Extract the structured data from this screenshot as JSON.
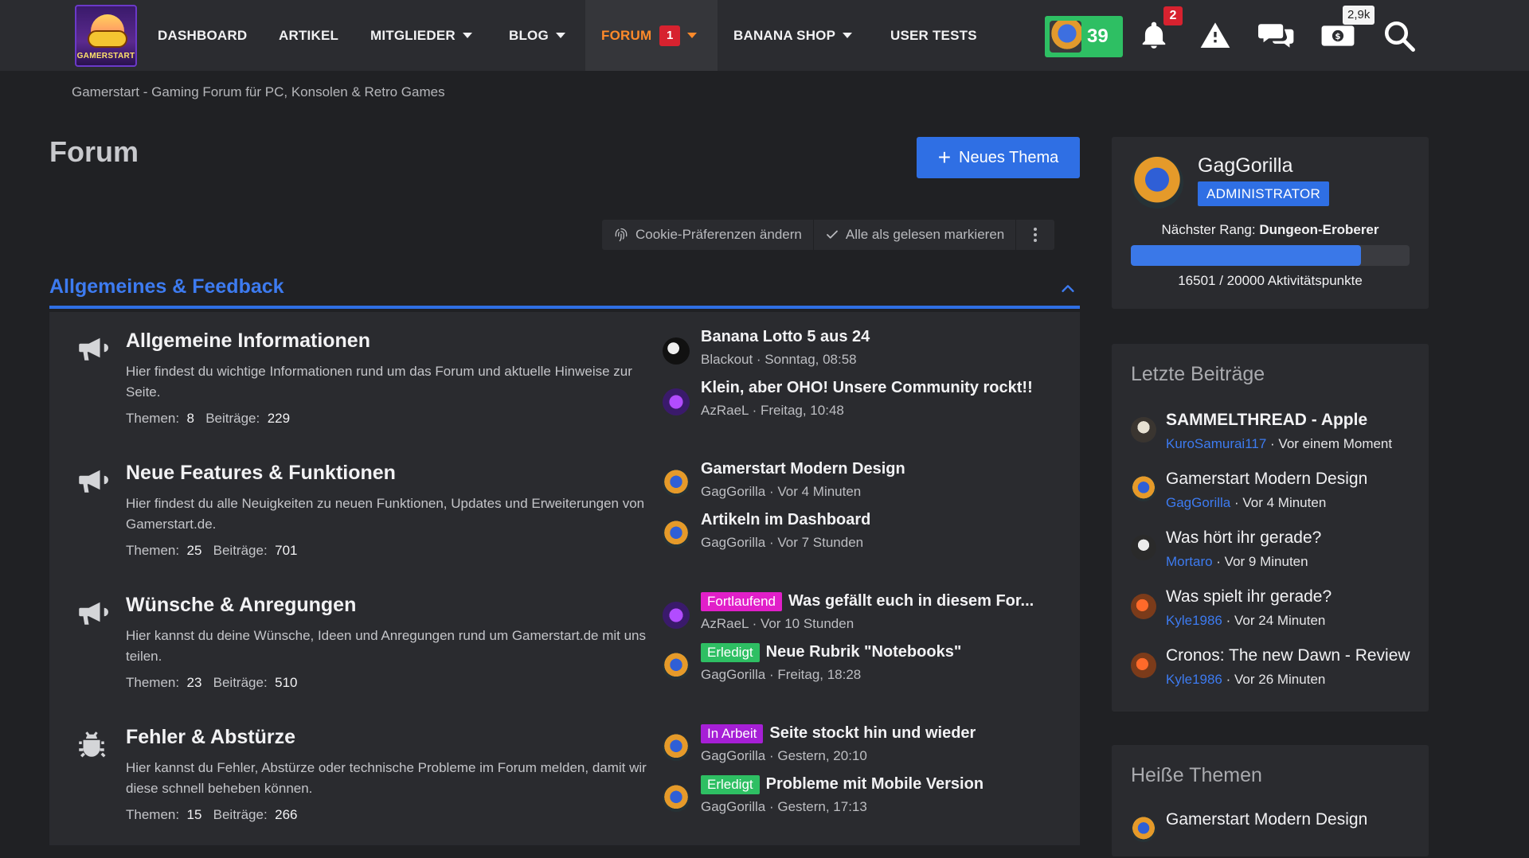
{
  "nav": {
    "logo_text": "GAMERSTART",
    "items": [
      {
        "label": "DASHBOARD"
      },
      {
        "label": "ARTIKEL"
      },
      {
        "label": "MITGLIEDER"
      },
      {
        "label": "BLOG"
      },
      {
        "label": "FORUM",
        "badge": "1"
      },
      {
        "label": "BANANA SHOP"
      },
      {
        "label": "USER TESTS"
      }
    ],
    "user_count": "39",
    "notifications_badge": "2",
    "money_badge": "2,9k",
    "icons": [
      "bell-icon",
      "alert-icon",
      "chat-icon",
      "money-icon",
      "search-icon"
    ]
  },
  "breadcrumb": "Gamerstart - Gaming Forum für PC, Konsolen & Retro Games",
  "page": {
    "title": "Forum",
    "new_topic_label": "Neues Thema",
    "toolbar": {
      "cookie": "Cookie-Präferenzen ändern",
      "mark_read": "Alle als gelesen markieren"
    }
  },
  "category": {
    "title": "Allgemeines & Feedback",
    "forums": [
      {
        "icon": "megaphone-icon",
        "title": "Allgemeine Informationen",
        "desc": "Hier findest du wichtige Informationen rund um das Forum und aktuelle Hinweise zur Seite.",
        "themen_label": "Themen:",
        "themen": "8",
        "beitraege_label": "Beiträge:",
        "beitraege": "229",
        "latest": [
          {
            "avatar": "av-black",
            "prefix": "",
            "prefix_color": "",
            "title": "Banana Lotto 5 aus 24",
            "meta": "Blackout · Sonntag, 08:58"
          },
          {
            "avatar": "av-az",
            "prefix": "",
            "prefix_color": "",
            "title": "Klein, aber OHO! Unsere Community rockt!!",
            "meta": "AzRaeL · Freitag, 10:48"
          }
        ]
      },
      {
        "icon": "megaphone-icon",
        "title": "Neue Features & Funktionen",
        "desc": "Hier findest du alle Neuigkeiten zu neuen Funktionen, Updates und Erweiterungen von Gamerstart.de.",
        "themen_label": "Themen:",
        "themen": "25",
        "beitraege_label": "Beiträge:",
        "beitraege": "701",
        "latest": [
          {
            "avatar": "av-gag",
            "prefix": "",
            "prefix_color": "",
            "title": "Gamerstart Modern Design",
            "meta": "GagGorilla · Vor 4 Minuten"
          },
          {
            "avatar": "av-gag",
            "prefix": "",
            "prefix_color": "",
            "title": "Artikeln im Dashboard",
            "meta": "GagGorilla · Vor 7 Stunden"
          }
        ]
      },
      {
        "icon": "megaphone-icon",
        "title": "Wünsche & Anregungen",
        "desc": "Hier kannst du deine Wünsche, Ideen und Anregungen rund um Gamerstart.de mit uns teilen.",
        "themen_label": "Themen:",
        "themen": "23",
        "beitraege_label": "Beiträge:",
        "beitraege": "510",
        "latest": [
          {
            "avatar": "av-az",
            "prefix": "Fortlaufend",
            "prefix_color": "#e11fc9",
            "title": "Was gefällt euch in diesem For...",
            "meta": "AzRaeL · Vor 10 Stunden"
          },
          {
            "avatar": "av-gag",
            "prefix": "Erledigt",
            "prefix_color": "#2ebf63",
            "title": "Neue Rubrik \"Notebooks\"",
            "meta": "GagGorilla · Freitag, 18:28"
          }
        ]
      },
      {
        "icon": "bug-icon",
        "title": "Fehler & Abstürze",
        "desc": "Hier kannst du Fehler, Abstürze oder technische Probleme im Forum melden, damit wir diese schnell beheben können.",
        "themen_label": "Themen:",
        "themen": "15",
        "beitraege_label": "Beiträge:",
        "beitraege": "266",
        "latest": [
          {
            "avatar": "av-gag",
            "prefix": "In Arbeit",
            "prefix_color": "#a61fd6",
            "title": "Seite stockt hin und wieder",
            "meta": "GagGorilla · Gestern, 20:10"
          },
          {
            "avatar": "av-gag",
            "prefix": "Erledigt",
            "prefix_color": "#2ebf63",
            "title": "Probleme mit Mobile Version",
            "meta": "GagGorilla · Gestern, 17:13"
          }
        ]
      }
    ]
  },
  "sidebar": {
    "profile": {
      "name": "GagGorilla",
      "role": "ADMINISTRATOR",
      "next_rank_label": "Nächster Rang:",
      "next_rank": "Dungeon-Eroberer",
      "progress_fraction": 0.825,
      "points": "16501 / 20000 Aktivitätspunkte"
    },
    "latest_posts": {
      "title": "Letzte Beiträge",
      "items": [
        {
          "avatar": "av-kuro",
          "title": "SAMMELTHREAD - Apple",
          "bold": true,
          "user": "KuroSamurai117",
          "time": " · Vor einem Moment"
        },
        {
          "avatar": "av-gag",
          "title": "Gamerstart Modern Design",
          "bold": false,
          "user": "GagGorilla",
          "time": " · Vor 4 Minuten"
        },
        {
          "avatar": "av-mort",
          "title": "Was hört ihr gerade?",
          "bold": false,
          "user": "Mortaro",
          "time": " · Vor 9 Minuten"
        },
        {
          "avatar": "av-kyle",
          "title": "Was spielt ihr gerade?",
          "bold": false,
          "user": "Kyle1986",
          "time": " · Vor 24 Minuten"
        },
        {
          "avatar": "av-kyle",
          "title": "Cronos: The new Dawn - Review",
          "bold": false,
          "user": "Kyle1986",
          "time": " · Vor 26 Minuten"
        }
      ]
    },
    "hot_topics": {
      "title": "Heiße Themen",
      "items": [
        {
          "avatar": "av-gag",
          "title": "Gamerstart Modern Design"
        }
      ]
    }
  }
}
